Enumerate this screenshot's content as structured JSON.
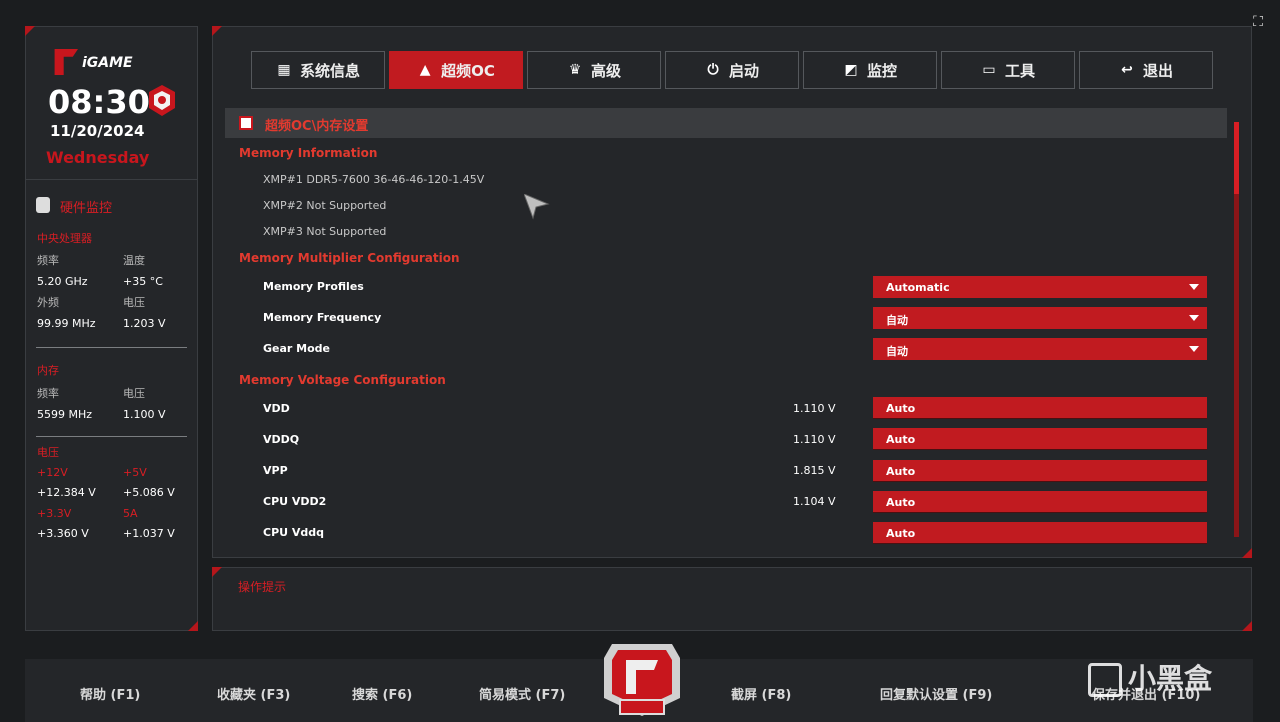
{
  "brand": {
    "logo_text": "iGAME"
  },
  "status": {
    "time": "08:30",
    "date": "11/20/2024",
    "weekday": "Wednesday"
  },
  "hw_monitor": {
    "title": "硬件监控",
    "cpu": {
      "title": "中央处理器",
      "freq_label": "频率",
      "freq_value": "5.20 GHz",
      "temp_label": "温度",
      "temp_value": "+35 °C",
      "ext_label": "外频",
      "ext_value": "99.99 MHz",
      "volt_label": "电压",
      "volt_value": "1.203 V"
    },
    "memory": {
      "title": "内存",
      "freq_label": "频率",
      "freq_value": "5599 MHz",
      "volt_label": "电压",
      "volt_value": "1.100 V"
    },
    "voltage": {
      "title": "电压",
      "v12_label": "+12V",
      "v12_value": "+12.384 V",
      "v5_label": "+5V",
      "v5_value": "+5.086 V",
      "v33_label": "+3.3V",
      "v33_value": "+3.360 V",
      "v5a_label": "5A",
      "v5a_value": "+1.037 V"
    }
  },
  "tabs": [
    {
      "label": "系统信息",
      "icon": "grid-icon"
    },
    {
      "label": "超频OC",
      "icon": "rocket-icon",
      "active": true
    },
    {
      "label": "高级",
      "icon": "crown-icon"
    },
    {
      "label": "启动",
      "icon": "power-icon"
    },
    {
      "label": "监控",
      "icon": "monitor-icon"
    },
    {
      "label": "工具",
      "icon": "toolbox-icon"
    },
    {
      "label": "退出",
      "icon": "back-arrow-icon"
    }
  ],
  "breadcrumb": "超频OC\\内存设置",
  "memory_info": {
    "title": "Memory Information",
    "xmp1": "XMP#1 DDR5-7600 36-46-46-120-1.45V",
    "xmp2": "XMP#2 Not Supported",
    "xmp3": "XMP#3 Not Supported"
  },
  "multiplier": {
    "title": "Memory Multiplier Configuration",
    "profiles_label": "Memory Profiles",
    "profiles_value": "Automatic",
    "freq_label": "Memory Frequency",
    "freq_value": "自动",
    "gear_label": "Gear Mode",
    "gear_value": "自动"
  },
  "voltage_cfg": {
    "title": "Memory Voltage Configuration",
    "rows": [
      {
        "label": "VDD",
        "reading": "1.110 V",
        "value": "Auto"
      },
      {
        "label": "VDDQ",
        "reading": "1.110 V",
        "value": "Auto"
      },
      {
        "label": "VPP",
        "reading": "1.815 V",
        "value": "Auto"
      },
      {
        "label": "CPU VDD2",
        "reading": "1.104 V",
        "value": "Auto"
      },
      {
        "label": "CPU Vddq",
        "reading": "",
        "value": "Auto"
      }
    ]
  },
  "hint": {
    "title": "操作提示"
  },
  "footer": {
    "help": "帮助 (F1)",
    "favorites": "收藏夹 (F3)",
    "search": "搜索 (F6)",
    "easy_mode": "简易模式 (F7)",
    "screenshot": "截屏 (F8)",
    "defaults": "回复默认设置 (F9)",
    "save_exit": "保存并退出 (F10)"
  },
  "watermark": "小黑盒",
  "colors": {
    "accent": "#c11b20",
    "panel": "#242629",
    "background": "#1b1d1f"
  }
}
